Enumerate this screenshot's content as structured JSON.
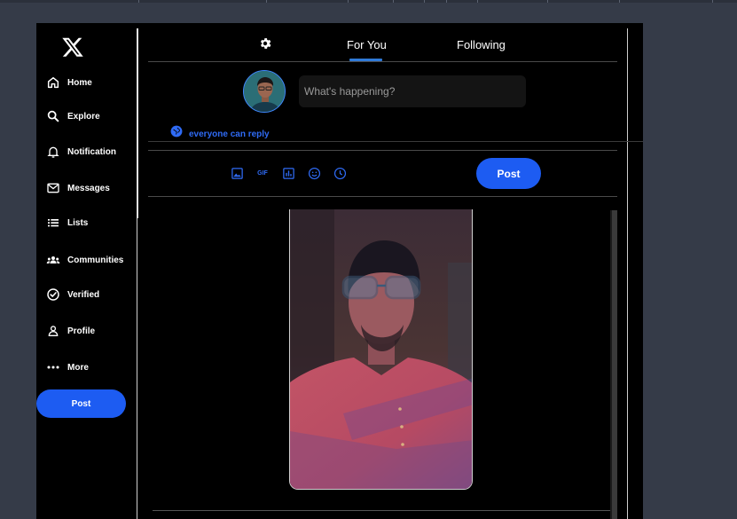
{
  "sidebar": {
    "logo_icon": "x-logo-icon",
    "items": [
      {
        "label": "Home",
        "icon": "home-icon"
      },
      {
        "label": "Explore",
        "icon": "search-icon"
      },
      {
        "label": "Notification",
        "icon": "bell-icon"
      },
      {
        "label": "Messages",
        "icon": "mail-icon"
      },
      {
        "label": "Lists",
        "icon": "list-icon"
      },
      {
        "label": "Communities",
        "icon": "people-icon"
      },
      {
        "label": "Verified",
        "icon": "check-circle-icon"
      },
      {
        "label": "Profile",
        "icon": "person-icon"
      },
      {
        "label": "More",
        "icon": "more-icon"
      }
    ],
    "post_label": "Post"
  },
  "header": {
    "settings_icon": "gear-icon",
    "tabs": [
      {
        "label": "For You",
        "active": true
      },
      {
        "label": "Following",
        "active": false
      }
    ]
  },
  "compose": {
    "placeholder": "What's happening?",
    "value": "",
    "reply_setting": "everyone can reply",
    "tools": [
      {
        "icon": "image-icon"
      },
      {
        "icon": "gif-icon",
        "text": "GIF"
      },
      {
        "icon": "poll-icon"
      },
      {
        "icon": "emoji-icon"
      },
      {
        "icon": "schedule-icon"
      }
    ],
    "post_label": "Post"
  },
  "colors": {
    "accent": "#1d5cf2",
    "accent_text": "#2f6bf5",
    "tab_underline": "#2f7ad8",
    "background": "#000000",
    "desktop": "#353b48"
  }
}
